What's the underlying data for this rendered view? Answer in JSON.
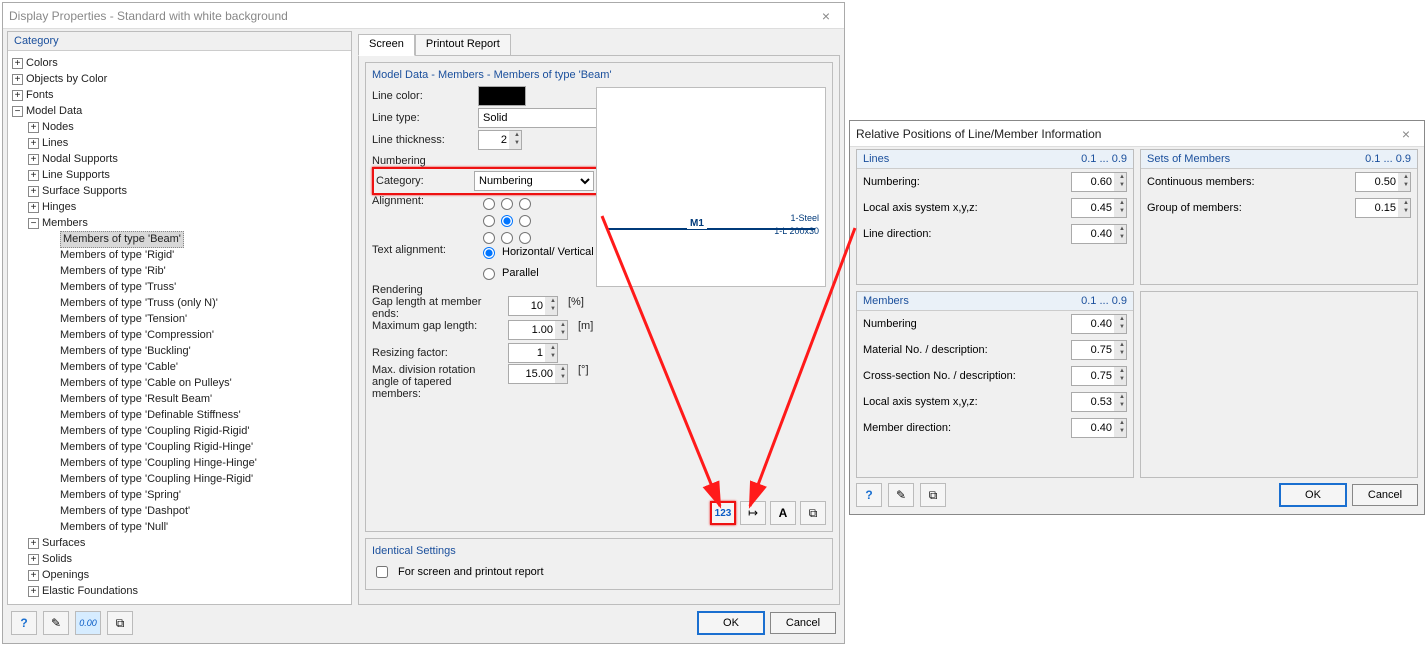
{
  "window1": {
    "title": "Display Properties - Standard with white background",
    "category_panel": "Category",
    "tree": {
      "colors": "Colors",
      "objbycolor": "Objects by Color",
      "fonts": "Fonts",
      "modeldata": "Model Data",
      "nodes": "Nodes",
      "lines": "Lines",
      "nodalsupports": "Nodal Supports",
      "linesupports": "Line Supports",
      "surfacesupports": "Surface Supports",
      "hinges": "Hinges",
      "members": "Members",
      "m_beam": "Members of type 'Beam'",
      "m_rigid": "Members of type 'Rigid'",
      "m_rib": "Members of type 'Rib'",
      "m_truss": "Members of type 'Truss'",
      "m_trussn": "Members of type 'Truss (only N)'",
      "m_tension": "Members of type 'Tension'",
      "m_compression": "Members of type 'Compression'",
      "m_buckling": "Members of type 'Buckling'",
      "m_cable": "Members of type 'Cable'",
      "m_cablep": "Members of type 'Cable on Pulleys'",
      "m_resbeam": "Members of type 'Result Beam'",
      "m_defstiff": "Members of type 'Definable Stiffness'",
      "m_crr": "Members of type 'Coupling Rigid-Rigid'",
      "m_crh": "Members of type 'Coupling Rigid-Hinge'",
      "m_chh": "Members of type 'Coupling Hinge-Hinge'",
      "m_chr": "Members of type 'Coupling Hinge-Rigid'",
      "m_spring": "Members of type 'Spring'",
      "m_dashpot": "Members of type 'Dashpot'",
      "m_null": "Members of type 'Null'",
      "surfaces": "Surfaces",
      "solids": "Solids",
      "openings": "Openings",
      "elastic": "Elastic Foundations"
    },
    "tabs": {
      "screen": "Screen",
      "printout": "Printout Report"
    },
    "groupbox_title": "Model Data - Members - Members of type 'Beam'",
    "labels": {
      "linecolor": "Line color:",
      "linetype": "Line type:",
      "linethickness": "Line thickness:",
      "numbering": "Numbering",
      "category": "Category:",
      "alignment": "Alignment:",
      "textalign": "Text alignment:",
      "horizvert": "Horizontal/ Vertical",
      "parallel": "Parallel",
      "rendering": "Rendering",
      "gaplen": "Gap length at member ends:",
      "maxgap": "Maximum gap length:",
      "resize": "Resizing factor:",
      "maxdiv": "Max. division rotation angle of tapered members:",
      "identical": "Identical Settings",
      "chklabel": "For screen and printout report"
    },
    "values": {
      "linetype": "Solid",
      "thickness": "2",
      "category_sel": "Numbering",
      "gap": "10",
      "maxgap": "1.00",
      "resize": "1",
      "maxdiv": "15.00"
    },
    "units": {
      "pct": "[%]",
      "m": "[m]",
      "deg": "[°]"
    },
    "preview": {
      "m1": "M1",
      "steel": "1-Steel",
      "sect": "1-L 200x30"
    },
    "buttons": {
      "ok": "OK",
      "cancel": "Cancel"
    }
  },
  "window2": {
    "title": "Relative Positions of Line/Member Information",
    "range": "0.1 ... 0.9",
    "groups": {
      "lines": "Lines",
      "members": "Members",
      "sets": "Sets of Members"
    },
    "lines": {
      "numbering_label": "Numbering:",
      "numbering_val": "0.60",
      "axis_label": "Local axis system x,y,z:",
      "axis_val": "0.45",
      "dir_label": "Line direction:",
      "dir_val": "0.40"
    },
    "members": {
      "numbering_label": "Numbering",
      "numbering_val": "0.40",
      "mat_label": "Material No. / description:",
      "mat_val": "0.75",
      "cs_label": "Cross-section No. / description:",
      "cs_val": "0.75",
      "axis_label": "Local axis system x,y,z:",
      "axis_val": "0.53",
      "dir_label": "Member direction:",
      "dir_val": "0.40"
    },
    "sets": {
      "cont_label": "Continuous members:",
      "cont_val": "0.50",
      "group_label": "Group of members:",
      "group_val": "0.15"
    },
    "buttons": {
      "ok": "OK",
      "cancel": "Cancel"
    }
  }
}
